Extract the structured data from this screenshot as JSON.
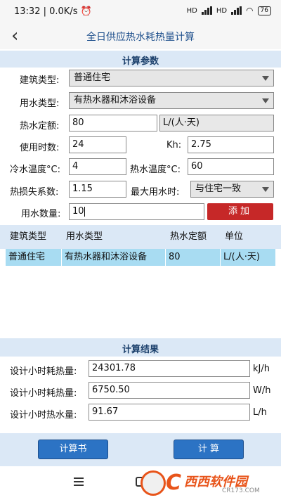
{
  "status_bar": {
    "time": "13:32",
    "speed": "0.0K/s",
    "signal1": "HD",
    "signal2": "HD",
    "battery": "76"
  },
  "titlebar": {
    "title": "全日供应热水耗热量计算"
  },
  "params": {
    "header": "计算参数",
    "building_type": {
      "label": "建筑类型:",
      "value": "普通住宅"
    },
    "water_type": {
      "label": "用水类型:",
      "value": "有热水器和沐浴设备"
    },
    "quota": {
      "label": "热水定额:",
      "value": "80",
      "unit": "L/(人·天)"
    },
    "hours": {
      "label": "使用时数:",
      "value": "24"
    },
    "kh": {
      "label": "Kh:",
      "value": "2.75"
    },
    "cold_temp": {
      "label": "冷水温度°C:",
      "value": "4"
    },
    "hot_temp": {
      "label": "热水温度°C:",
      "value": "60"
    },
    "loss_coef": {
      "label": "热损失系数:",
      "value": "1.15"
    },
    "max_time": {
      "label": "最大用水时:",
      "value": "与住宅一致"
    },
    "water_count": {
      "label": "用水数量:",
      "value": "10"
    },
    "add_button": "添加"
  },
  "table": {
    "columns": [
      "建筑类型",
      "用水类型",
      "热水定额",
      "单位"
    ],
    "rows": [
      [
        "普通住宅",
        "有热水器和沐浴设备",
        "80",
        "L/(人·天)"
      ]
    ]
  },
  "results": {
    "header": "计算结果",
    "hourly_heat_kj": {
      "label": "设计小时耗热量:",
      "value": "24301.78",
      "unit": "kJ/h"
    },
    "hourly_heat_w": {
      "label": "设计小时耗热量:",
      "value": "6750.50",
      "unit": "W/h"
    },
    "hourly_water": {
      "label": "设计小时热水量:",
      "value": "91.67",
      "unit": "L/h"
    }
  },
  "buttons": {
    "report": "计算书",
    "calculate": "计 算"
  },
  "watermark": {
    "brand": "西西软件园",
    "url": "CR173.COM"
  },
  "colors": {
    "accent": "#2c73c4",
    "add": "#c62828",
    "band": "#dbe8f6",
    "selected_row": "#a8dcf2"
  }
}
